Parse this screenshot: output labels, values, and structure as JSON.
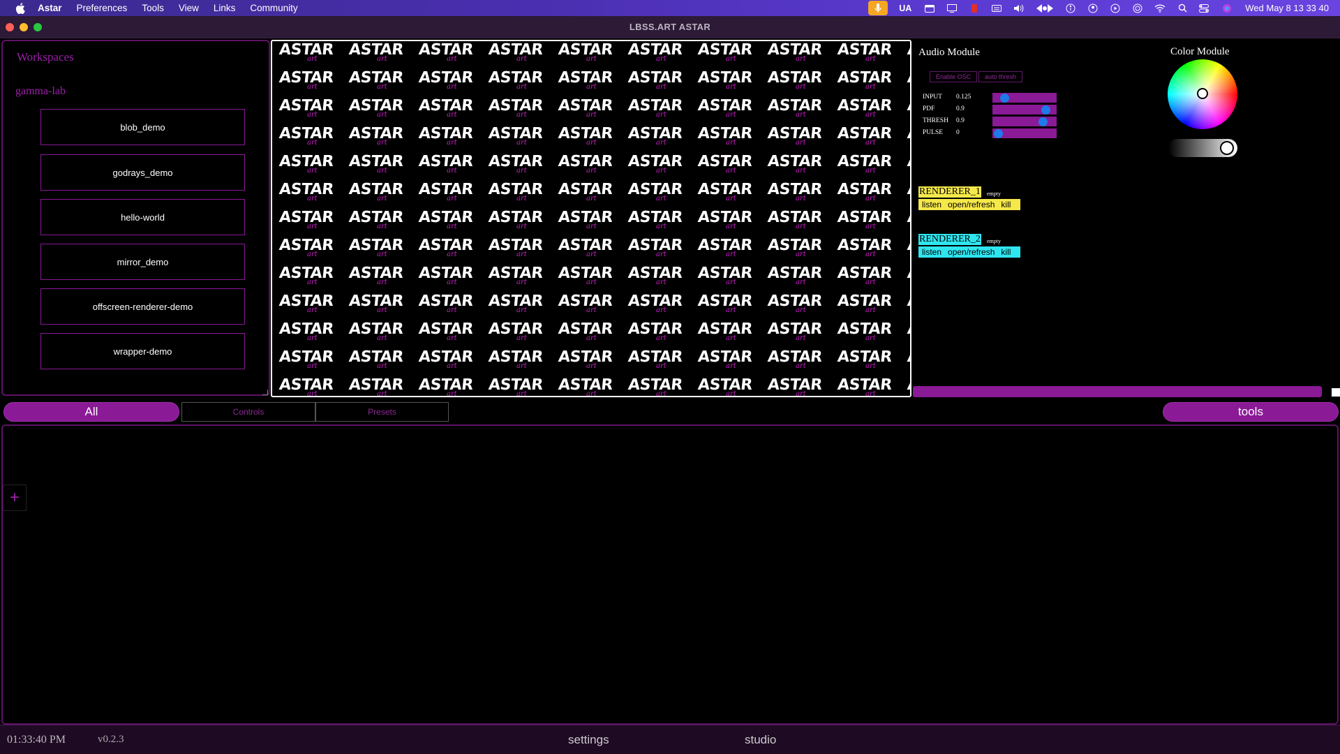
{
  "menubar": {
    "app": "Astar",
    "items": [
      "Preferences",
      "Tools",
      "View",
      "Links",
      "Community"
    ],
    "input_source": "UA",
    "clock": "Wed May 8  13 33 40"
  },
  "window": {
    "title": "LBSS.ART ASTAR"
  },
  "sidebar": {
    "heading": "Workspaces",
    "group": "gamma-lab",
    "workspaces": [
      "blob_demo",
      "godrays_demo",
      "hello-world",
      "mirror_demo",
      "offscreen-renderer-demo",
      "wrapper-demo"
    ]
  },
  "preview": {
    "tile_word": "ASTAR",
    "tile_scribble": "art"
  },
  "audio": {
    "title": "Audio Module",
    "enable_osc": "Enable OSC",
    "auto_thresh": "auto thresh",
    "params": [
      {
        "name": "INPUT",
        "value": "0.125",
        "level": 0.125
      },
      {
        "name": "PDF",
        "value": "0.9",
        "level": 0.9
      },
      {
        "name": "THRESH",
        "value": "0.9",
        "level": 0.85
      },
      {
        "name": "PULSE",
        "value": "0",
        "level": 0.0
      }
    ]
  },
  "renderers": [
    {
      "name": "RENDERER_1",
      "status": "empty",
      "color": "#f5e84a",
      "actions": [
        "listen",
        "open/refresh",
        "kill"
      ]
    },
    {
      "name": "RENDERER_2",
      "status": "empty",
      "color": "#2ee6f0",
      "actions": [
        "listen",
        "open/refresh",
        "kill"
      ]
    }
  ],
  "color_module": {
    "title": "Color Module"
  },
  "tabs": {
    "all": "All",
    "controls": "Controls",
    "presets": "Presets",
    "tools": "tools"
  },
  "main": {
    "add_label": "+"
  },
  "footer": {
    "time": "01:33:40 PM",
    "version": "v0.2.3",
    "settings": "settings",
    "studio": "studio"
  },
  "colors": {
    "accent": "#8a1a96",
    "border": "#5f1266"
  }
}
